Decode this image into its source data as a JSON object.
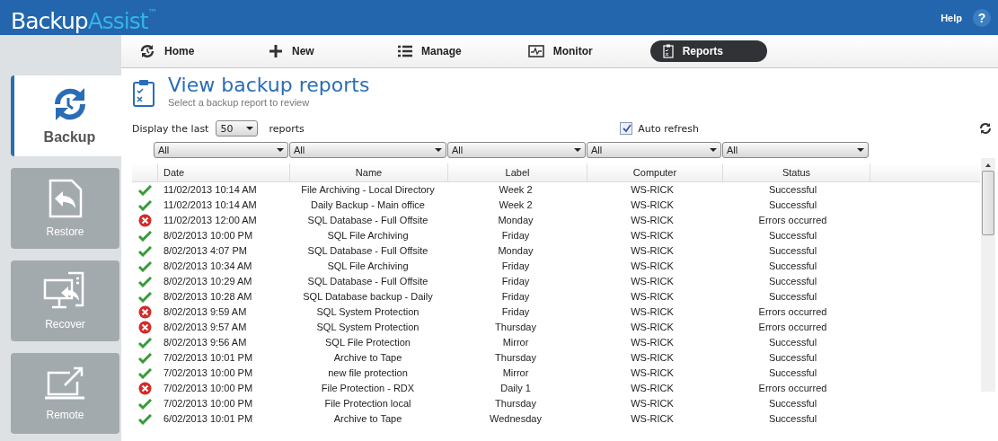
{
  "header": {
    "logo_main": "Backup",
    "logo_accent": "Assist",
    "logo_mark": "™",
    "help": "Help",
    "help_icon": "?"
  },
  "sidebar": {
    "items": [
      {
        "label": "Backup",
        "selected": true
      },
      {
        "label": "Restore",
        "selected": false
      },
      {
        "label": "Recover",
        "selected": false
      },
      {
        "label": "Remote",
        "selected": false
      }
    ]
  },
  "nav": {
    "items": [
      {
        "label": "Home",
        "selected": false
      },
      {
        "label": "New",
        "selected": false
      },
      {
        "label": "Manage",
        "selected": false
      },
      {
        "label": "Monitor",
        "selected": false
      },
      {
        "label": "Reports",
        "selected": true
      }
    ]
  },
  "page": {
    "title": "View backup reports",
    "subtitle": "Select a backup report to review"
  },
  "display_last": {
    "label": "Display the last",
    "value": "50",
    "suffix": "reports"
  },
  "auto_refresh": {
    "label": "Auto refresh",
    "checked": true
  },
  "filters": [
    "All",
    "All",
    "All",
    "All",
    "All"
  ],
  "table": {
    "columns": [
      "Date",
      "Name",
      "Label",
      "Computer",
      "Status"
    ],
    "rows": [
      {
        "ok": true,
        "cells": [
          "11/02/2013 10:14 AM",
          "File Archiving - Local Directory",
          "Week 2",
          "WS-RICK",
          "Successful"
        ]
      },
      {
        "ok": true,
        "cells": [
          "11/02/2013 10:14 AM",
          "Daily Backup - Main office",
          "Week 2",
          "WS-RICK",
          "Successful"
        ]
      },
      {
        "ok": false,
        "cells": [
          "11/02/2013 12:00 AM",
          "SQL Database - Full Offsite",
          "Monday",
          "WS-RICK",
          "Errors occurred"
        ]
      },
      {
        "ok": true,
        "cells": [
          "8/02/2013 10:00 PM",
          "SQL File Archiving",
          "Friday",
          "WS-RICK",
          "Successful"
        ]
      },
      {
        "ok": true,
        "cells": [
          "8/02/2013 4:07 PM",
          "SQL Database - Full Offsite",
          "Monday",
          "WS-RICK",
          "Successful"
        ]
      },
      {
        "ok": true,
        "cells": [
          "8/02/2013 10:34 AM",
          "SQL File Archiving",
          "Friday",
          "WS-RICK",
          "Successful"
        ]
      },
      {
        "ok": true,
        "cells": [
          "8/02/2013 10:29 AM",
          "SQL Database - Full Offsite",
          "Friday",
          "WS-RICK",
          "Successful"
        ]
      },
      {
        "ok": true,
        "cells": [
          "8/02/2013 10:28 AM",
          "SQL Database backup - Daily",
          "Friday",
          "WS-RICK",
          "Successful"
        ]
      },
      {
        "ok": false,
        "cells": [
          "8/02/2013 9:59 AM",
          "SQL System Protection",
          "Friday",
          "WS-RICK",
          "Errors occurred"
        ]
      },
      {
        "ok": false,
        "cells": [
          "8/02/2013 9:57 AM",
          "SQL System Protection",
          "Thursday",
          "WS-RICK",
          "Errors occurred"
        ]
      },
      {
        "ok": true,
        "cells": [
          "8/02/2013 9:56 AM",
          "SQL File Protection",
          "Mirror",
          "WS-RICK",
          "Successful"
        ]
      },
      {
        "ok": true,
        "cells": [
          "7/02/2013 10:01 PM",
          "Archive to Tape",
          "Thursday",
          "WS-RICK",
          "Successful"
        ]
      },
      {
        "ok": true,
        "cells": [
          "7/02/2013 10:00 PM",
          "new file protection",
          "Mirror",
          "WS-RICK",
          "Successful"
        ]
      },
      {
        "ok": false,
        "cells": [
          "7/02/2013 10:00 PM",
          "File Protection - RDX",
          "Daily 1",
          "WS-RICK",
          "Errors occurred"
        ]
      },
      {
        "ok": true,
        "cells": [
          "7/02/2013 10:00 PM",
          "File Protection local",
          "Thursday",
          "WS-RICK",
          "Successful"
        ]
      },
      {
        "ok": true,
        "cells": [
          "6/02/2013 10:01 PM",
          "Archive to Tape",
          "Wednesday",
          "WS-RICK",
          "Successful"
        ]
      }
    ]
  }
}
